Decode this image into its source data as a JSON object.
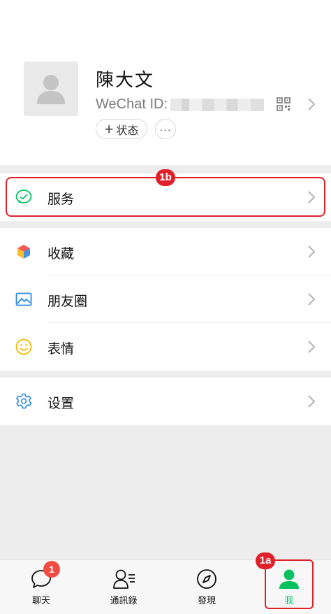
{
  "profile": {
    "name": "陳大文",
    "wechat_id_label": "WeChat ID:",
    "status_button": "状态",
    "more_button": "···"
  },
  "menu": {
    "services": "服务",
    "favorites": "收藏",
    "moments": "朋友圈",
    "stickers": "表情",
    "settings": "设置"
  },
  "annotations": {
    "badge_1a": "1a",
    "badge_1b": "1b"
  },
  "tabbar": {
    "tabs": [
      {
        "label": "聊天",
        "icon": "chat-bubble-icon",
        "unread": "1"
      },
      {
        "label": "通訊錄",
        "icon": "contacts-icon"
      },
      {
        "label": "發現",
        "icon": "compass-icon"
      },
      {
        "label": "我",
        "icon": "person-icon",
        "active": true
      }
    ]
  },
  "colors": {
    "accent_green": "#07c160",
    "highlight_red": "#e0202a"
  }
}
